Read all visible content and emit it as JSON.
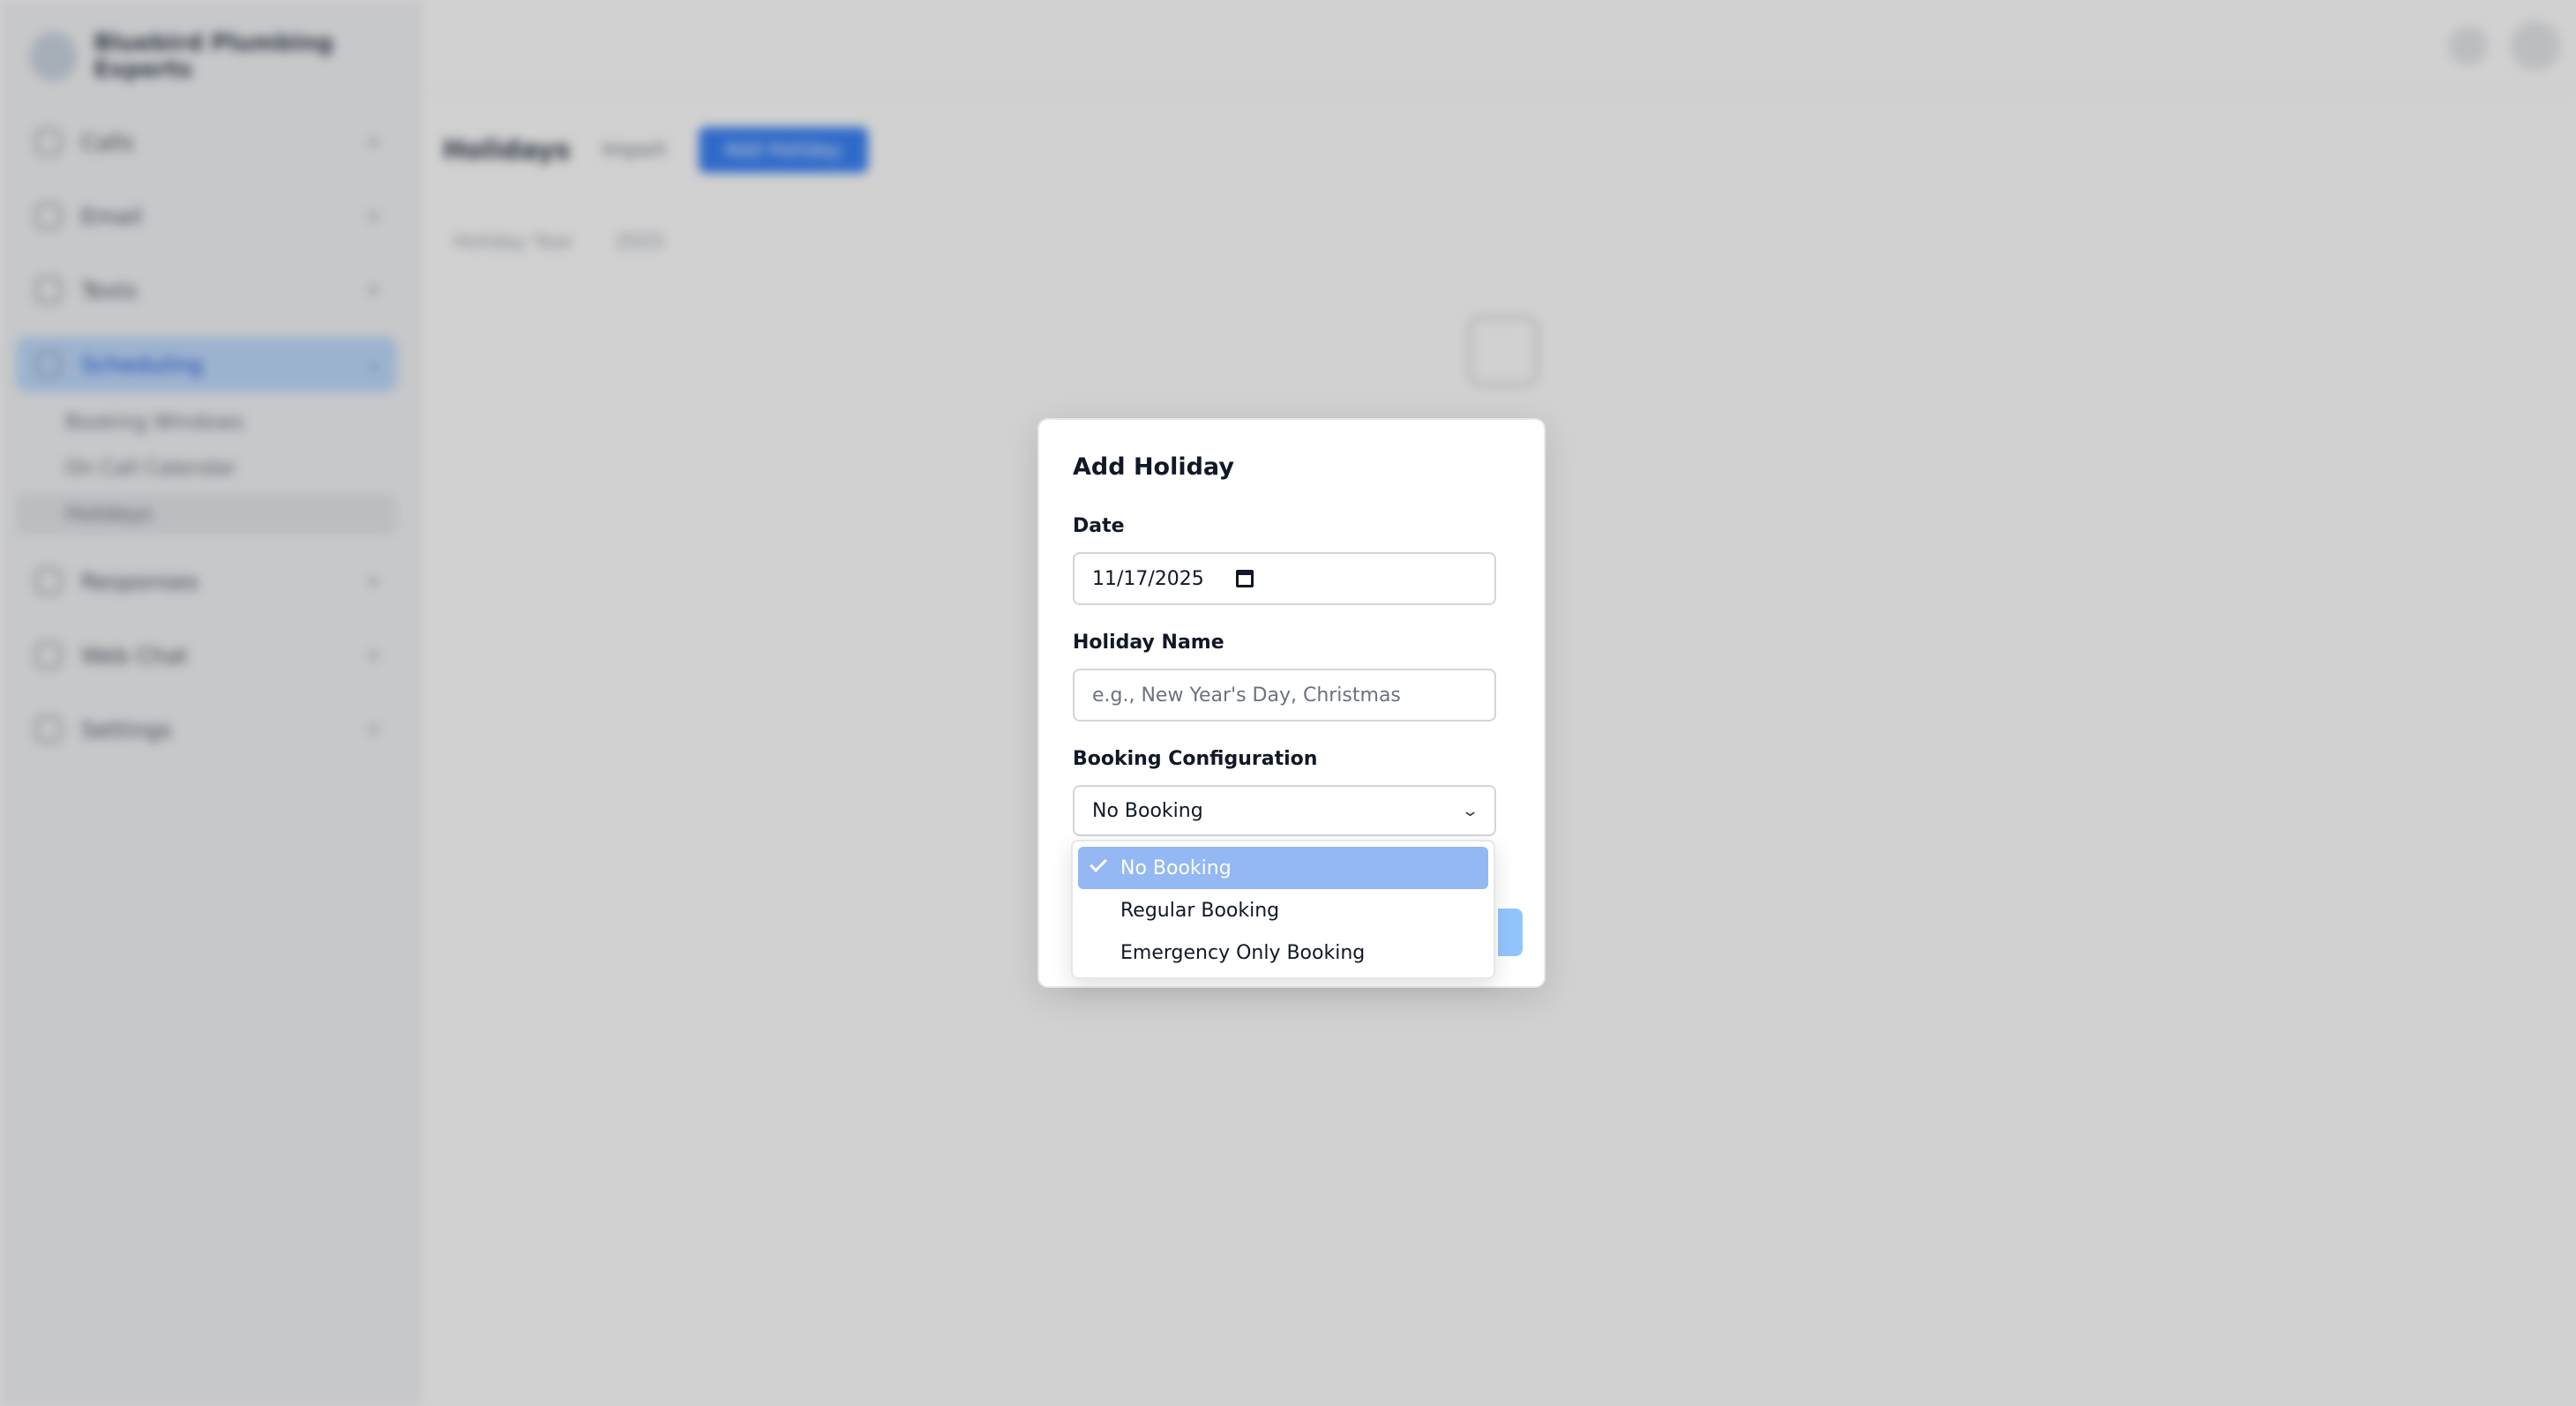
{
  "sidebar": {
    "brand": "Bluebird Plumbing Experts",
    "items": [
      {
        "label": "Calls"
      },
      {
        "label": "Email"
      },
      {
        "label": "Texts"
      },
      {
        "label": "Scheduling"
      },
      {
        "label": "Responses"
      },
      {
        "label": "Web Chat"
      },
      {
        "label": "Settings"
      }
    ],
    "sub_items": [
      {
        "label": "Booking Windows"
      },
      {
        "label": "On Call Calendar"
      },
      {
        "label": "Holidays"
      }
    ]
  },
  "page": {
    "title": "Holidays",
    "import_label": "Import",
    "add_label": "Add Holiday",
    "filter_label": "Holiday Year",
    "filter_value": "2025"
  },
  "modal": {
    "title": "Add Holiday",
    "date_label": "Date",
    "date_value": "11/17/2025",
    "name_label": "Holiday Name",
    "name_placeholder": "e.g., New Year's Day, Christmas",
    "booking_label": "Booking Configuration",
    "booking_value": "No Booking",
    "options": [
      {
        "label": "No Booking",
        "selected": true
      },
      {
        "label": "Regular Booking",
        "selected": false
      },
      {
        "label": "Emergency Only Booking",
        "selected": false
      }
    ]
  }
}
